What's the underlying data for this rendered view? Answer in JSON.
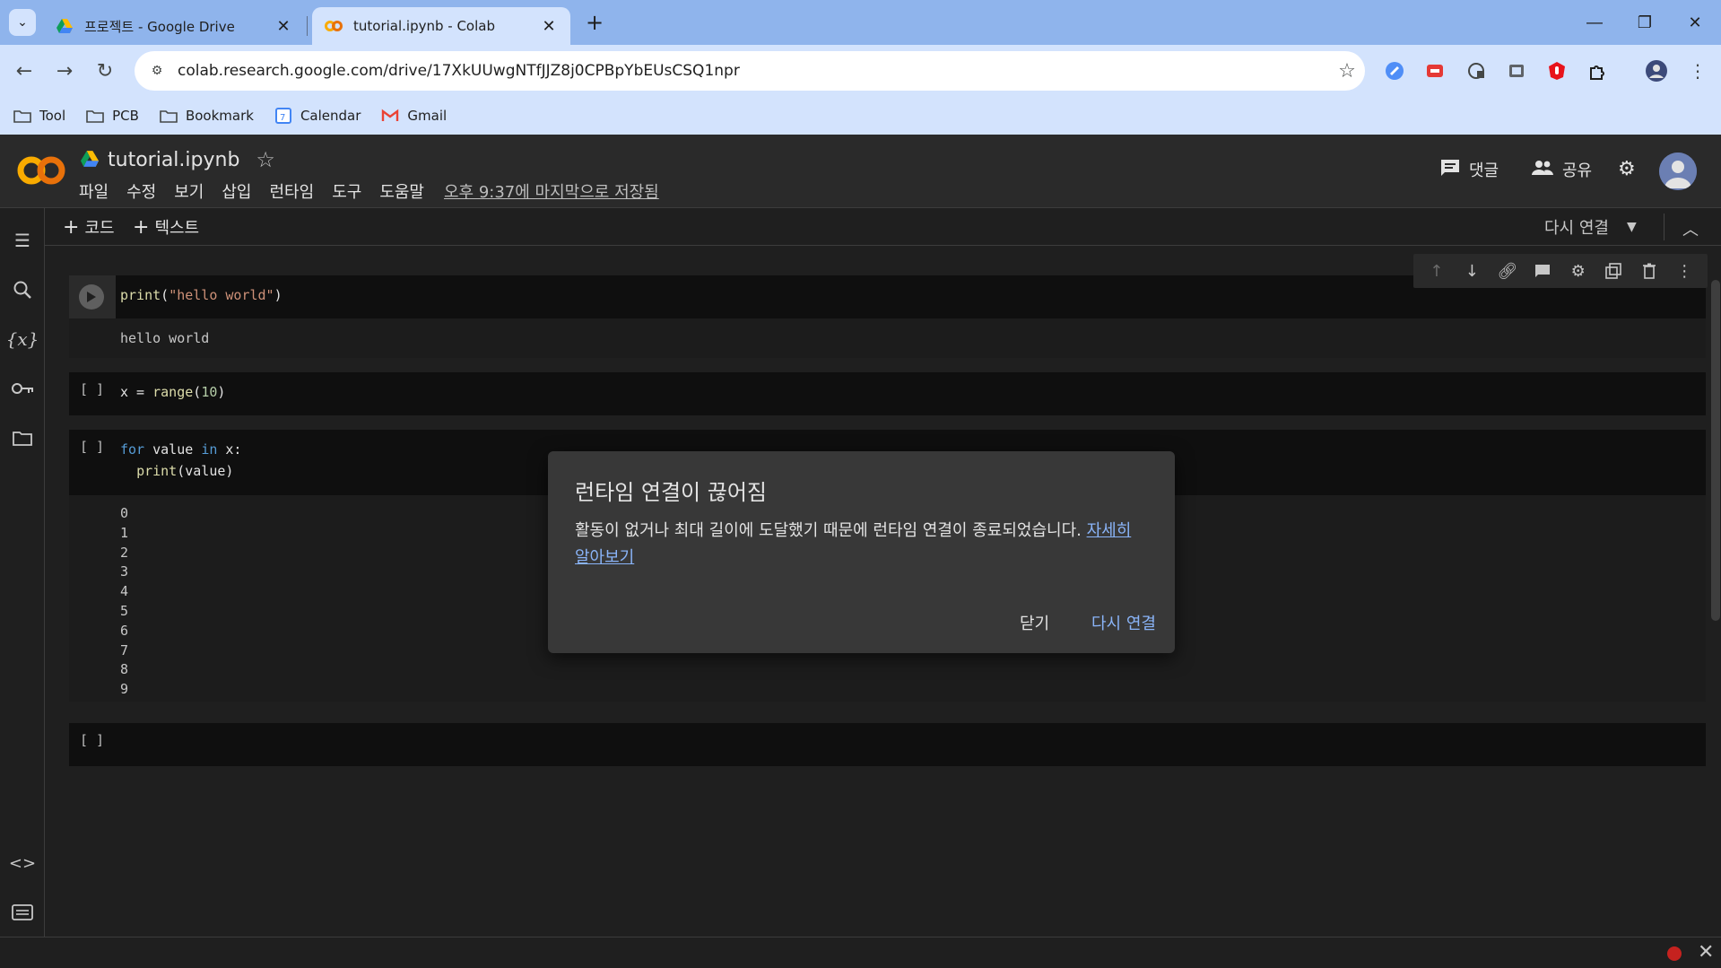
{
  "browser": {
    "tabs": [
      {
        "title": "프로젝트 - Google Drive",
        "active": false
      },
      {
        "title": "tutorial.ipynb - Colab",
        "active": true
      }
    ],
    "url": "colab.research.google.com/drive/17XkUUwgNTfJJZ8j0CPBpYbEUsCSQ1npr",
    "bookmarks": [
      "Tool",
      "PCB",
      "Bookmark",
      "Calendar",
      "Gmail"
    ]
  },
  "colab": {
    "notebook_title": "tutorial.ipynb",
    "menu": [
      "파일",
      "수정",
      "보기",
      "삽입",
      "런타임",
      "도구",
      "도움말"
    ],
    "last_saved": "오후 9:37에 마지막으로 저장됨",
    "comments_label": "댓글",
    "share_label": "공유",
    "add_code_label": "코드",
    "add_text_label": "텍스트",
    "reconnect_label": "다시 연결"
  },
  "cells": {
    "cell1": {
      "bracket": "",
      "output": "hello world"
    },
    "cell2": {
      "bracket": "[ ]"
    },
    "cell3": {
      "bracket": "[ ]",
      "output": "0\n1\n2\n3\n4\n5\n6\n7\n8\n9"
    },
    "cell4": {
      "bracket": "[ ]"
    }
  },
  "dialog": {
    "title": "런타임 연결이 끊어짐",
    "body": "활동이 없거나 최대 길이에 도달했기 때문에 런타임 연결이 종료되었습니다. ",
    "link": "자세히 알아보기",
    "close_label": "닫기",
    "reconnect_label": "다시 연결"
  },
  "colors": {
    "accent": "#8ab4f8",
    "status_error": "#c5221f",
    "colab_orange": "#f9ab00"
  }
}
